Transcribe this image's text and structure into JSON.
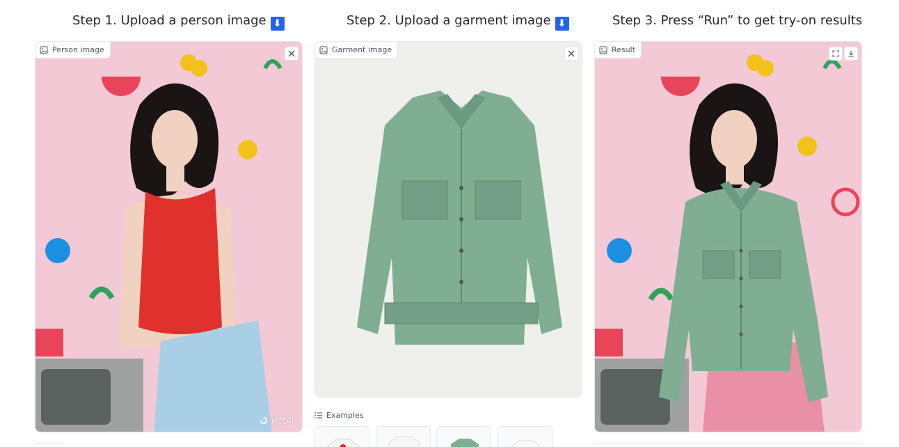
{
  "steps": [
    {
      "title": "Step 1. Upload a person image",
      "badge": "⬇"
    },
    {
      "title": "Step 2. Upload a garment image",
      "badge": "⬇"
    },
    {
      "title": "Step 3. Press “Run” to get try-on results"
    }
  ],
  "panels": {
    "person": {
      "label": "Person image",
      "watermark": "可灵AI"
    },
    "garment": {
      "label": "Garment image"
    },
    "result": {
      "label": "Result"
    }
  },
  "examples": {
    "label": "Examples"
  },
  "colors": {
    "pink_bg": "#f3c9d6",
    "red_top": "#e0312c",
    "jeans": "#a8cfe6",
    "jacket_green": "#7fae93",
    "pink_skirt": "#e98fa6",
    "hair": "#1a1414",
    "skin": "#f1d2c0"
  },
  "icons": [
    "image-icon",
    "close-icon",
    "fullscreen-icon",
    "download-icon",
    "list-icon"
  ]
}
